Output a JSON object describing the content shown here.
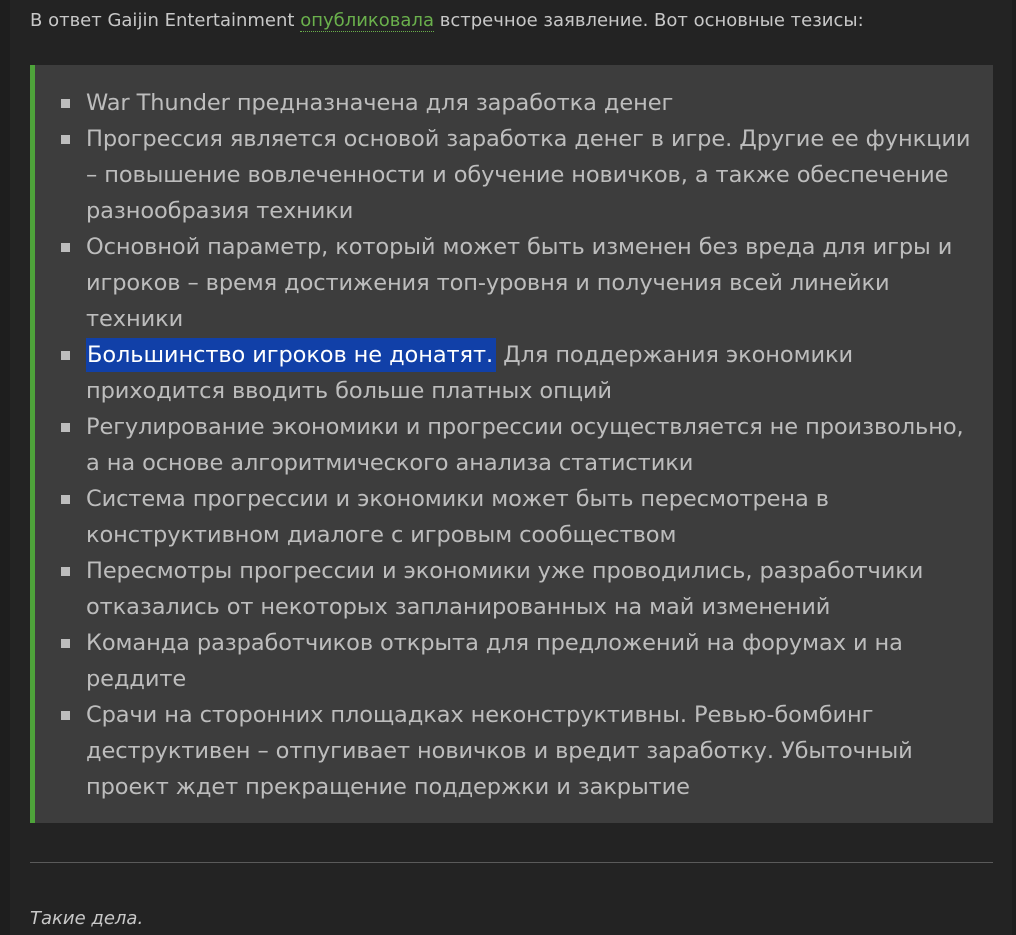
{
  "article": {
    "intro": {
      "prefix": "В ответ Gaijin Entertainment ",
      "link_text": "опубликовала",
      "suffix": " встречное заявление. Вот основные тезисы:"
    },
    "theses": [
      {
        "text": "War Thunder предназначена для заработка денег"
      },
      {
        "text": "Прогрессия является основой заработка денег в игре. Другие ее функции – повышение вовлеченности и обучение новичков, а также обеспечение разнообразия техники"
      },
      {
        "text": "Основной параметр, который может быть изменен без вреда для игры и игроков – время достижения топ-уровня и получения всей линейки техники"
      },
      {
        "highlighted": "Большинство игроков не донатят.",
        "text": " Для поддержания экономики приходится вводить больше платных опций"
      },
      {
        "text": "Регулирование экономики и прогрессии осуществляется не произвольно, а на основе алгоритмического анализа статистики"
      },
      {
        "text": "Система прогрессии и экономики может быть пересмотрена в конструктивном диалоге с игровым сообществом"
      },
      {
        "text": "Пересмотры прогрессии и экономики уже проводились, разработчики отказались от некоторых запланированных на май изменений"
      },
      {
        "text": "Команда разработчиков открыта для предложений на форумах и на реддите"
      },
      {
        "text": "Срачи на сторонних площадках неконструктивны. Ревью-бомбинг деструктивен – отпугивает новичков и вредит заработку. Убыточный проект ждет прекращение поддержки и закрытие"
      }
    ],
    "outro": "Такие дела."
  },
  "colors": {
    "page_background": "#232323",
    "quote_background": "#3d3d3d",
    "quote_accent": "#4ea33a",
    "link": "#6ab04c",
    "selection": "#1140a8"
  },
  "icons": {
    "bullet": "square-bullet-icon"
  }
}
